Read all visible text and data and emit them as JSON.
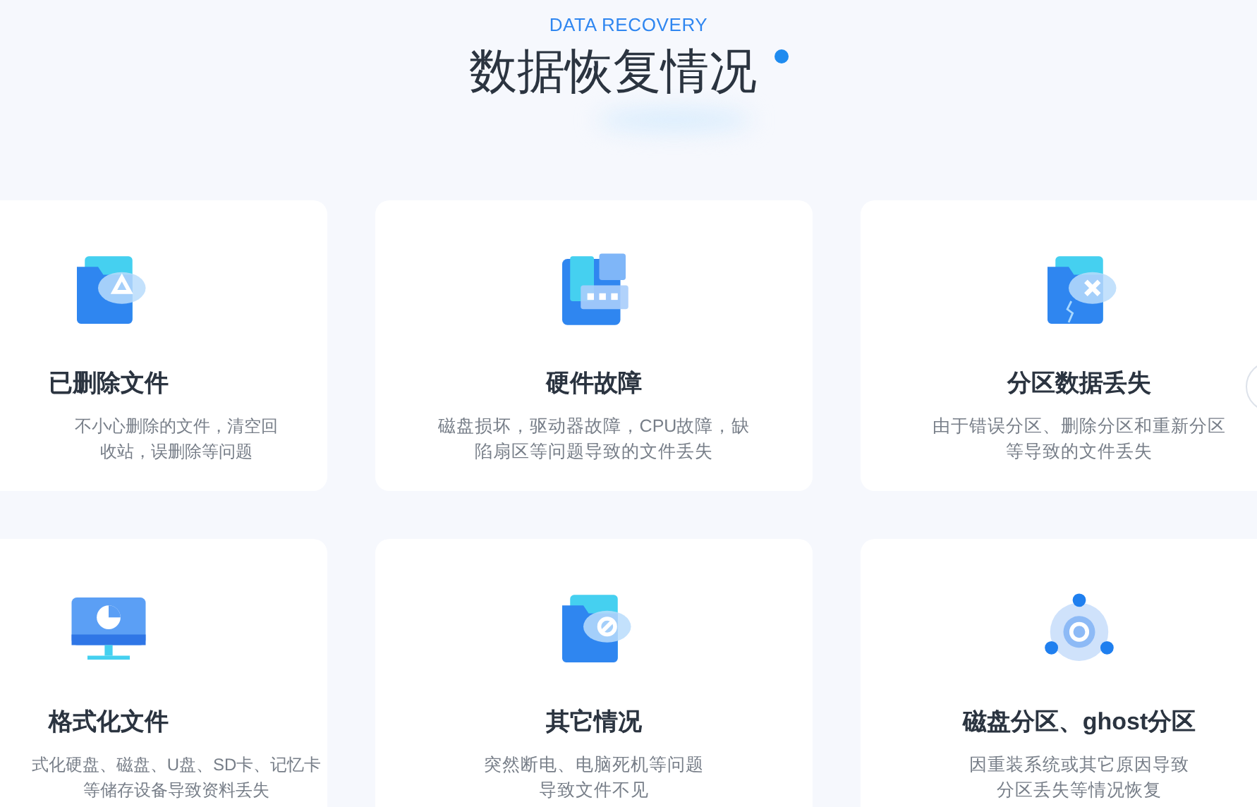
{
  "header": {
    "eyebrow": "DATA RECOVERY",
    "title": "数据恢复情况"
  },
  "cards": [
    {
      "title": "已删除文件",
      "lines": [
        "不小心删除的文件，清空回",
        "收站，误删除等问题"
      ]
    },
    {
      "title": "硬件故障",
      "lines": [
        "磁盘损坏，驱动器故障，CPU故障，缺",
        "陷扇区等问题导致的文件丢失"
      ]
    },
    {
      "title": "分区数据丢失",
      "lines": [
        "由于错误分区、删除分区和重新分区",
        "等导致的文件丢失"
      ]
    },
    {
      "title": "格式化文件",
      "lines": [
        "式化硬盘、磁盘、U盘、SD卡、记忆卡",
        "等储存设备导致资料丢失"
      ]
    },
    {
      "title": "其它情况",
      "lines": [
        "突然断电、电脑死机等问题",
        "导致文件不见"
      ]
    },
    {
      "title": "磁盘分区、ghost分区",
      "lines": [
        "因重装系统或其它原因导致",
        "分区丢失等情况恢复"
      ]
    }
  ]
}
